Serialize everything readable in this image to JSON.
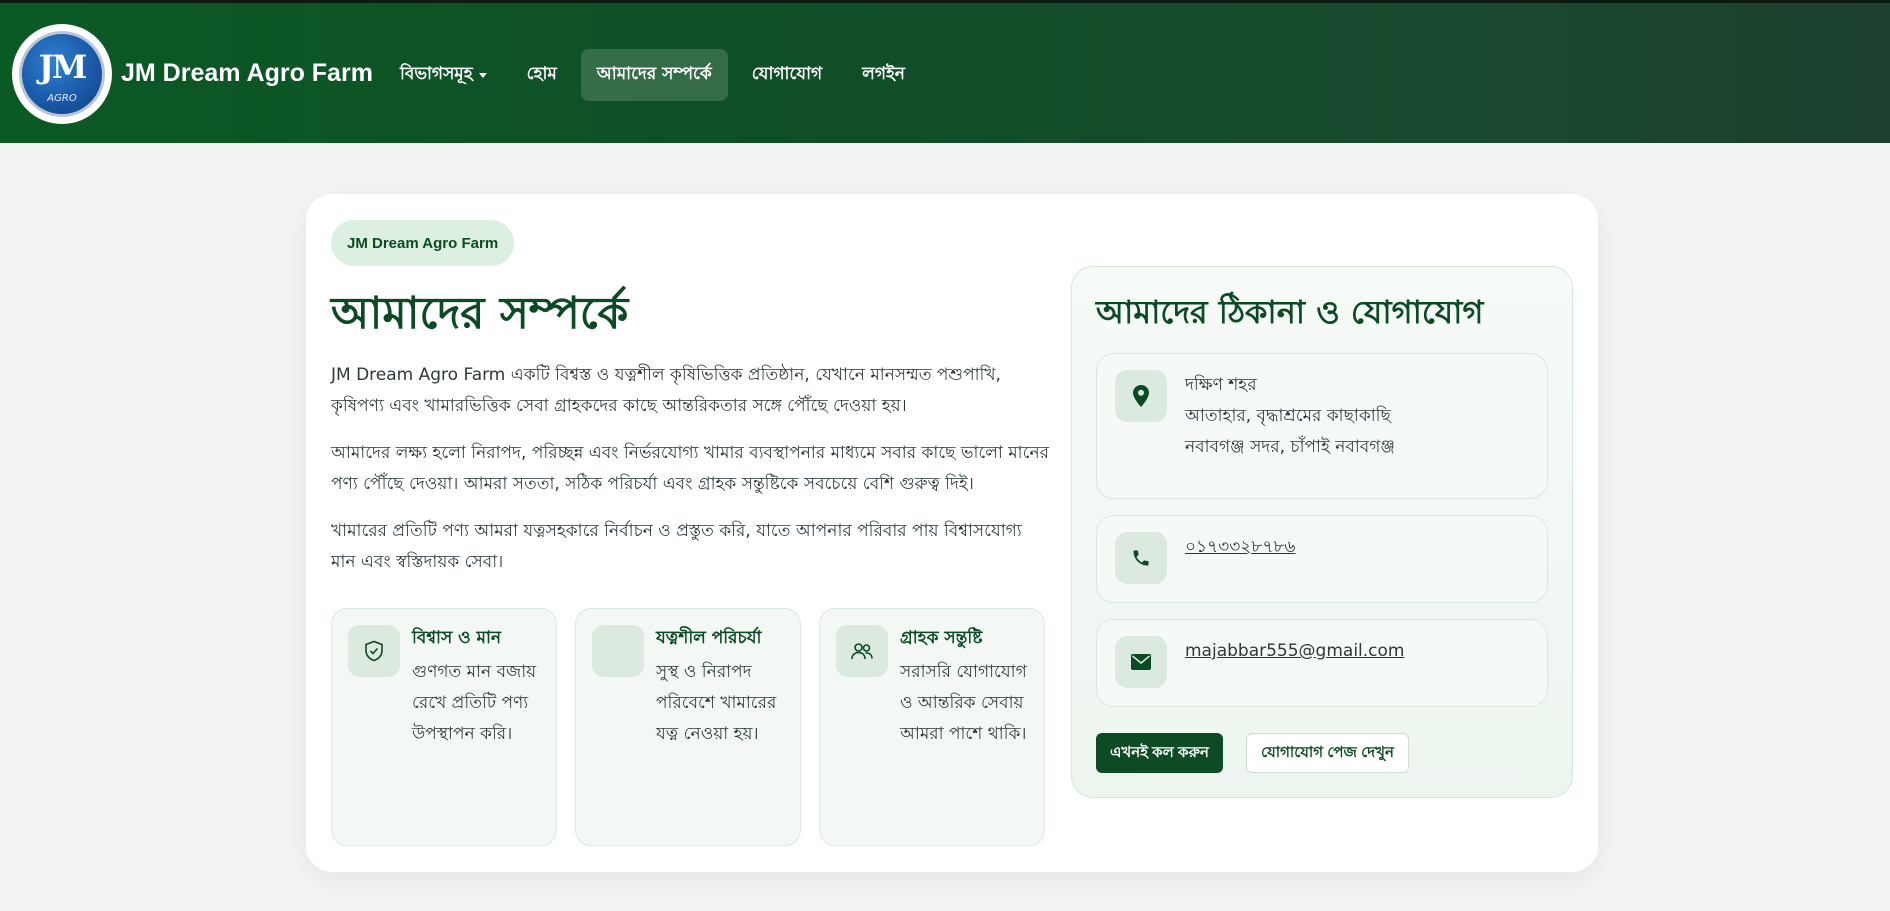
{
  "brand": {
    "logo_monogram": "JM",
    "logo_sub": "AGRO",
    "name": "JM Dream Agro Farm"
  },
  "nav": {
    "items": [
      {
        "label": "বিভাগসমূহ",
        "dropdown": true,
        "active": false
      },
      {
        "label": "হোম",
        "dropdown": false,
        "active": false
      },
      {
        "label": "আমাদের সম্পর্কে",
        "dropdown": false,
        "active": true
      },
      {
        "label": "যোগাযোগ",
        "dropdown": false,
        "active": false
      },
      {
        "label": "লগইন",
        "dropdown": false,
        "active": false
      }
    ]
  },
  "about": {
    "badge": "JM Dream Agro Farm",
    "title": "আমাদের সম্পর্কে",
    "paragraphs": [
      "JM Dream Agro Farm একটি বিশ্বস্ত ও যত্নশীল কৃষিভিত্তিক প্রতিষ্ঠান, যেখানে মানসম্মত পশুপাখি, কৃষিপণ্য এবং খামারভিত্তিক সেবা গ্রাহকদের কাছে আন্তরিকতার সঙ্গে পৌঁছে দেওয়া হয়।",
      "আমাদের লক্ষ্য হলো নিরাপদ, পরিচ্ছন্ন এবং নির্ভরযোগ্য খামার ব্যবস্থাপনার মাধ্যমে সবার কাছে ভালো মানের পণ্য পৌঁছে দেওয়া। আমরা সততা, সঠিক পরিচর্যা এবং গ্রাহক সন্তুষ্টিকে সবচেয়ে বেশি গুরুত্ব দিই।",
      "খামারের প্রতিটি পণ্য আমরা যত্নসহকারে নির্বাচন ও প্রস্তুত করি, যাতে আপনার পরিবার পায় বিশ্বাসযোগ্য মান এবং স্বস্তিদায়ক সেবা।"
    ],
    "features": [
      {
        "icon": "shield-check-icon",
        "title": "বিশ্বাস ও মান",
        "text": "গুণগত মান বজায় রেখে প্রতিটি পণ্য উপস্থাপন করি।"
      },
      {
        "icon": "care-icon",
        "title": "যত্নশীল পরিচর্যা",
        "text": "সুস্থ ও নিরাপদ পরিবেশে খামারের যত্ন নেওয়া হয়।"
      },
      {
        "icon": "users-icon",
        "title": "গ্রাহক সন্তুষ্টি",
        "text": "সরাসরি যোগাযোগ ও আন্তরিক সেবায় আমরা পাশে থাকি।"
      }
    ]
  },
  "contact": {
    "title": "আমাদের ঠিকানা ও যোগাযোগ",
    "address": [
      "দক্ষিণ শহর",
      "আতাহার, বৃদ্ধাশ্রমের কাছাকাছি",
      "নবাবগঞ্জ সদর, চাঁপাই নবাবগঞ্জ"
    ],
    "phone": "০১৭৩৩২৮৭৮৬",
    "email": "majabbar555@gmail.com",
    "call_button": "এখনই কল করুন",
    "contact_page_button": "যোগাযোগ পেজ দেখুন"
  },
  "colors": {
    "primary": "#0d4b24",
    "nav_gradient_start": "#0b5a24",
    "nav_gradient_end": "#1d3f2e",
    "badge_bg": "#dcefe1",
    "page_bg": "#f2f4f3"
  }
}
